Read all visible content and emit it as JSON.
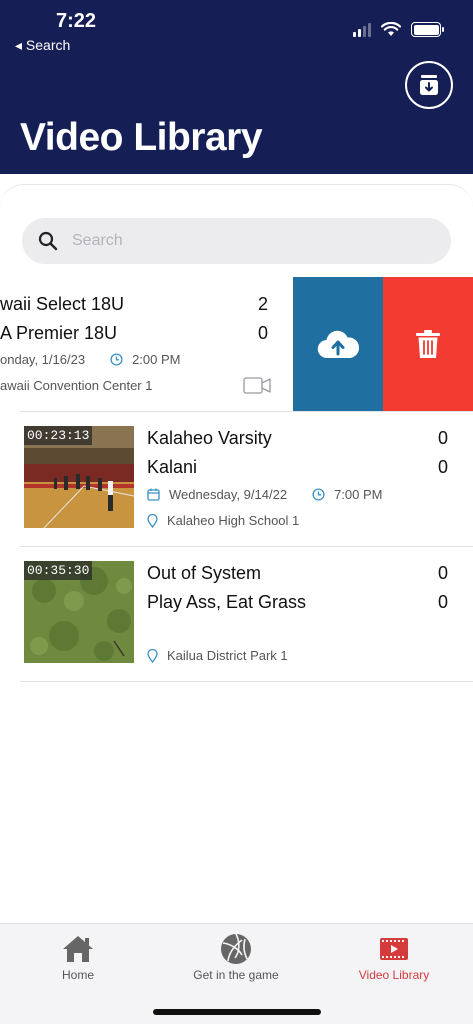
{
  "status_bar": {
    "time": "7:22",
    "back_label": "◂ Search"
  },
  "header": {
    "title": "Video Library"
  },
  "search": {
    "placeholder": "Search"
  },
  "games": [
    {
      "team1": "waii Select 18U",
      "score1": "2",
      "team2": "A Premier 18U",
      "score2": "0",
      "date": "onday, 1/16/23",
      "time": "2:00 PM",
      "location": "awaii Convention Center 1"
    },
    {
      "duration": "00:23:13",
      "team1": "Kalaheo Varsity",
      "score1": "0",
      "team2": "Kalani",
      "score2": "0",
      "date": "Wednesday, 9/14/22",
      "time": "7:00 PM",
      "location": "Kalaheo High School 1"
    },
    {
      "duration": "00:35:30",
      "team1": "Out of System",
      "score1": "0",
      "team2": "Play Ass, Eat Grass",
      "score2": "0",
      "location": "Kailua District Park 1"
    }
  ],
  "tabs": [
    {
      "label": "Home",
      "icon": "home-icon"
    },
    {
      "label": "Get in the game",
      "icon": "volleyball-icon"
    },
    {
      "label": "Video Library",
      "icon": "video-library-icon"
    }
  ],
  "colors": {
    "header_bg": "#151e55",
    "upload_action": "#1f6fa0",
    "delete_action": "#f23b31",
    "active_tab": "#d63b3b",
    "accent_icons": "#3a8fc8"
  }
}
